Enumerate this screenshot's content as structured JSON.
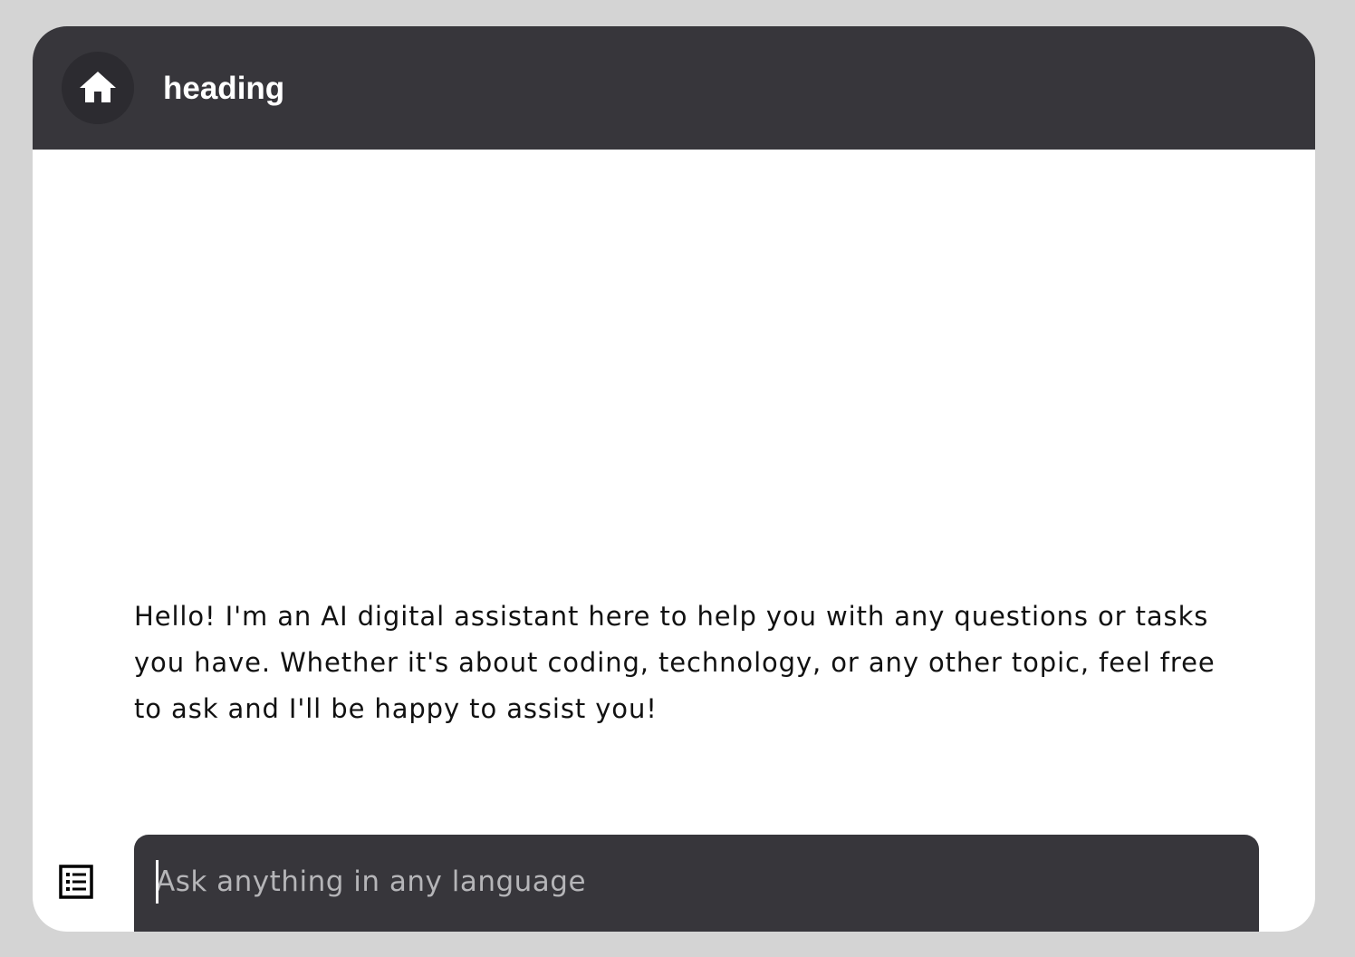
{
  "header": {
    "title": "heading",
    "home_icon": "home-icon",
    "background_color": "#37363b"
  },
  "chat": {
    "messages": [
      {
        "text": "Hello! I'm an AI digital assistant here to help you with any questions or tasks you have. Whether it's about coding, technology, or any other topic, feel free to ask and I'll be happy to assist you!"
      }
    ]
  },
  "composer": {
    "list_icon": "list-icon",
    "input_value": "",
    "input_placeholder": "Ask anything in any language"
  }
}
